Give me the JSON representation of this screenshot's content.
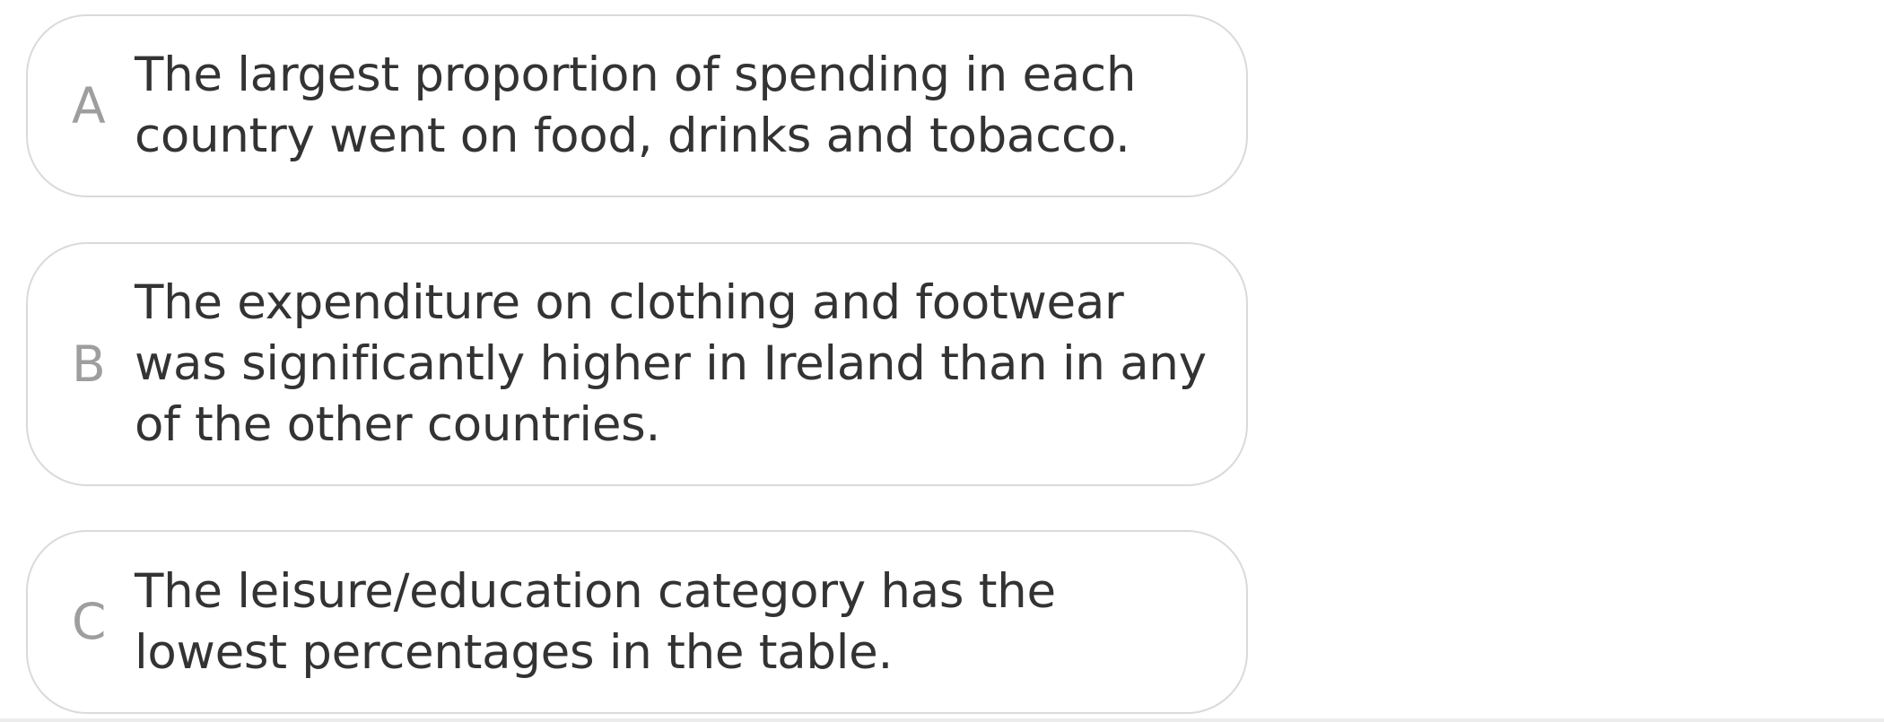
{
  "options": [
    {
      "letter": "A",
      "text": "The largest proportion of spending in each country went on food, drinks and tobacco."
    },
    {
      "letter": "B",
      "text": "The expenditure on clothing and footwear was significantly higher in Ireland than in any of the other countries."
    },
    {
      "letter": "C",
      "text": "The leisure/education category has the lowest percentages in the table."
    }
  ],
  "colors": {
    "border": "#dadada",
    "letter": "#9e9e9e",
    "text": "#333333",
    "background": "#ffffff"
  }
}
